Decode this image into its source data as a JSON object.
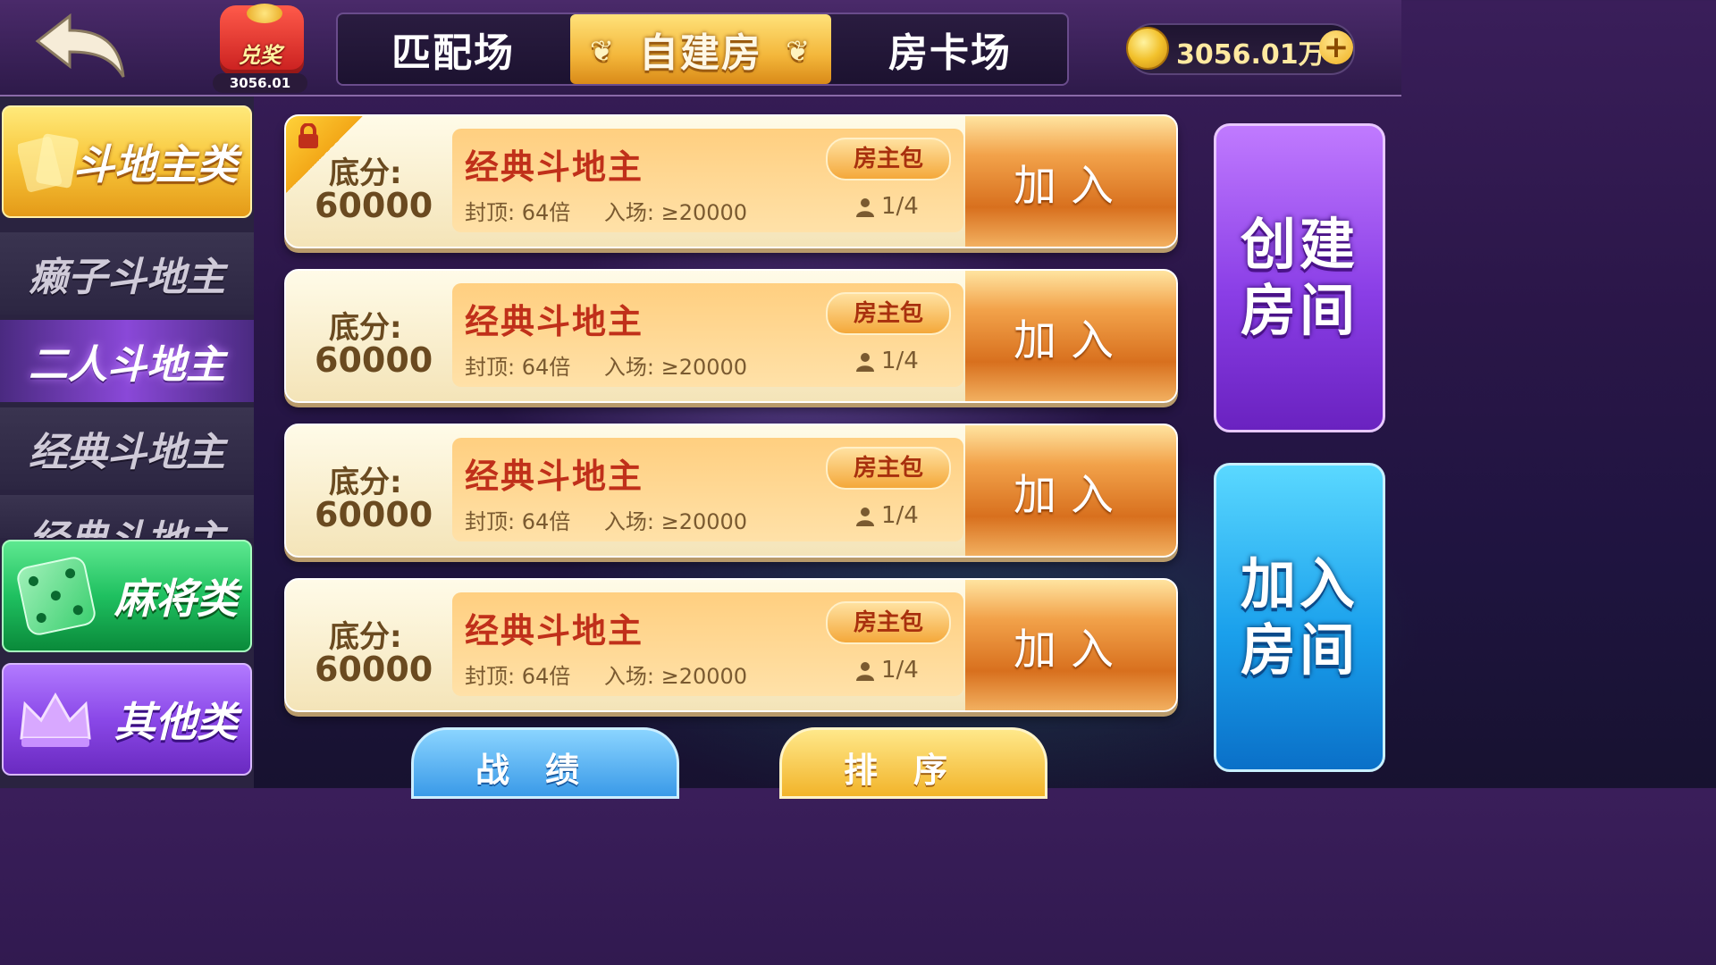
{
  "header": {
    "redeem_label": "兑奖",
    "redeem_amount": "3056.01",
    "tabs": [
      {
        "label": "匹配场",
        "active": false
      },
      {
        "label": "自建房",
        "active": true
      },
      {
        "label": "房卡场",
        "active": false
      }
    ],
    "coins": "3056.01万"
  },
  "sidebar": {
    "categories": {
      "doudizhu": "斗地主类",
      "mahjong": "麻将类",
      "other": "其他类"
    },
    "sub_items": [
      {
        "label": "癞子斗地主",
        "active": false
      },
      {
        "label": "二人斗地主",
        "active": true
      },
      {
        "label": "经典斗地主",
        "active": false
      },
      {
        "label": "经典斗地主",
        "active": false
      }
    ]
  },
  "rooms": [
    {
      "score_label": "底分:",
      "score": "60000",
      "name": "经典斗地主",
      "cap": "封顶: 64倍",
      "entry": "入场: ≥20000",
      "badge": "房主包",
      "players": "1/4",
      "join": "加入",
      "locked": true
    },
    {
      "score_label": "底分:",
      "score": "60000",
      "name": "经典斗地主",
      "cap": "封顶: 64倍",
      "entry": "入场: ≥20000",
      "badge": "房主包",
      "players": "1/4",
      "join": "加入",
      "locked": false
    },
    {
      "score_label": "底分:",
      "score": "60000",
      "name": "经典斗地主",
      "cap": "封顶: 64倍",
      "entry": "入场: ≥20000",
      "badge": "房主包",
      "players": "1/4",
      "join": "加入",
      "locked": false
    },
    {
      "score_label": "底分:",
      "score": "60000",
      "name": "经典斗地主",
      "cap": "封顶: 64倍",
      "entry": "入场: ≥20000",
      "badge": "房主包",
      "players": "1/4",
      "join": "加入",
      "locked": false
    }
  ],
  "actions": {
    "create_line1": "创建",
    "create_line2": "房间",
    "join_line1": "加入",
    "join_line2": "房间"
  },
  "bottom": {
    "stats": "战绩",
    "sort": "排序"
  },
  "colors": {
    "accent_gold": "#f3b63a",
    "room_name_red": "#c0301a",
    "create_purple": "#8a3ee6",
    "join_blue": "#1aa0ec"
  }
}
